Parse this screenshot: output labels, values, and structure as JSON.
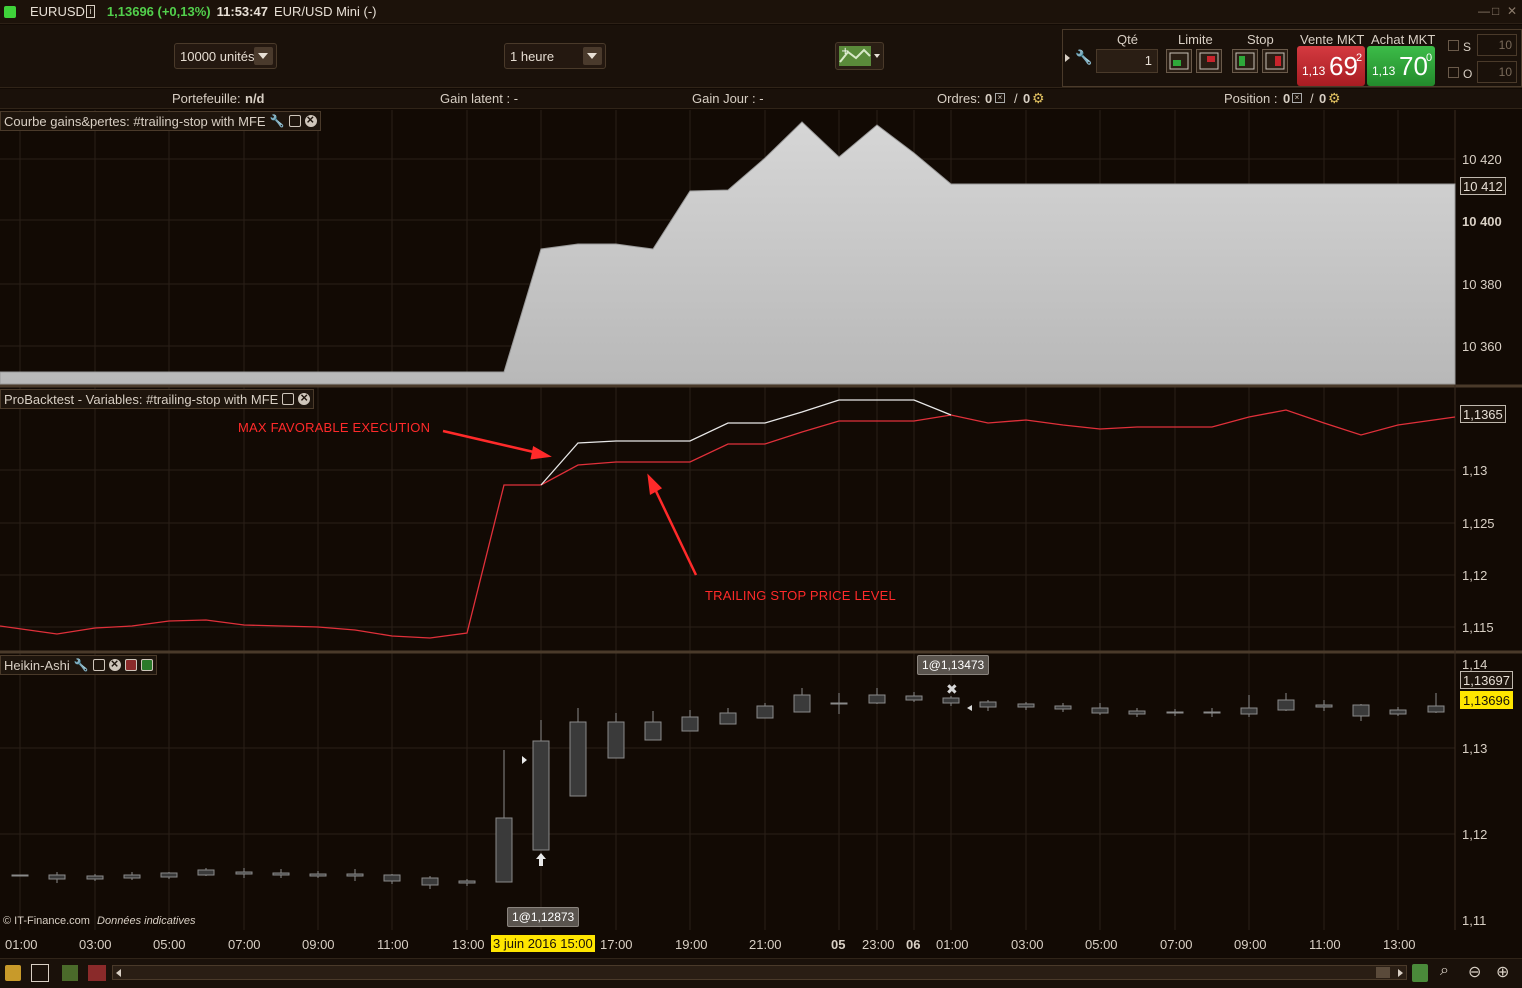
{
  "titlebar": {
    "symbol": "EURUSD",
    "price_change": "1,13696 (+0,13%)",
    "time": "11:53:47",
    "instrument_name": "EUR/USD Mini (-)"
  },
  "toolbar": {
    "quantity_select": "10000 unités",
    "interval_select": "1 heure",
    "qty_label": "Qté",
    "qty_value": "1",
    "limit_label": "Limite",
    "stop_label": "Stop",
    "sell_label": "Vente MKT",
    "buy_label": "Achat MKT",
    "sell_price_prefix": "1,13",
    "sell_price_main": "69",
    "sell_price_sup": "2",
    "buy_price_prefix": "1,13",
    "buy_price_main": "70",
    "buy_price_sup": "0",
    "s_label": "S",
    "o_label": "O",
    "s_value": "10",
    "o_value": "10"
  },
  "statusbar": {
    "portfolio_label": "Portefeuille:",
    "portfolio_value": "n/d",
    "gain_latent": "Gain latent : -",
    "gain_jour": "Gain Jour : -",
    "orders_label": "Ordres:",
    "orders_a": "0",
    "orders_sep": "/",
    "orders_b": "0",
    "position_label": "Position :",
    "position_a": "0",
    "position_sep": "/",
    "position_b": "0"
  },
  "panels": {
    "equity_title": "Courbe gains&pertes: #trailing-stop with MFE",
    "variables_title": "ProBacktest - Variables: #trailing-stop with MFE",
    "price_title": "Heikin-Ashi"
  },
  "equity_axis": {
    "labels": [
      "10 420",
      "10 400",
      "10 380",
      "10 360"
    ],
    "current": "10 412"
  },
  "variables_axis": {
    "labels": [
      "1,13",
      "1,125",
      "1,12",
      "1,115"
    ],
    "current": "1,1365"
  },
  "price_axis": {
    "labels": [
      "1,14",
      "1,13",
      "1,12",
      "1,11"
    ],
    "current_a": "1,13697",
    "current_b": "1,13696"
  },
  "annotations": {
    "mfe": "MAX FAVORABLE EXECUTION",
    "trailing": "TRAILING STOP PRICE LEVEL"
  },
  "tooltips": {
    "entry": "1@1,12873",
    "exit": "1@1,13473"
  },
  "credits": {
    "source": "© IT-Finance.com",
    "note": "Données indicatives"
  },
  "time_axis": [
    "01:00",
    "03:00",
    "05:00",
    "07:00",
    "09:00",
    "11:00",
    "13:00",
    "3 juin 2016 15:00",
    "17:00",
    "19:00",
    "21:00",
    "05",
    "23:00",
    "06",
    "01:00",
    "03:00",
    "05:00",
    "07:00",
    "09:00",
    "11:00",
    "13:00"
  ],
  "colors": {
    "background": "#120a04",
    "sell": "#c8242c",
    "buy": "#2ea83a",
    "trailing_line": "#e0303a",
    "mfe_line": "#e8e8e8",
    "equity_fill": "#cfcfcf",
    "highlight": "#ffe600"
  },
  "icons": [
    "wrench-icon",
    "window-icon",
    "close-icon",
    "indicator-icon",
    "cart-limit-icon",
    "cart-stop-icon",
    "zoom-in-icon",
    "zoom-out-icon"
  ]
}
